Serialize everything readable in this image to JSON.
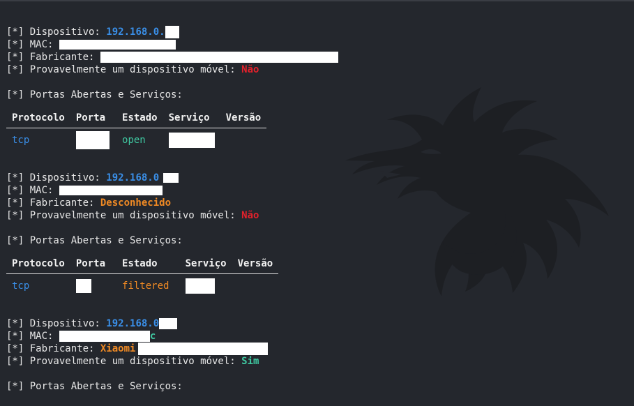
{
  "colors": {
    "background": "#24272d",
    "ip": "#3a8fe8",
    "negative": "#e3212b",
    "vendor": "#f08a24",
    "positive": "#3fc7a0"
  },
  "labels": {
    "device": "[*] Dispositivo: ",
    "mac": "[*] MAC: ",
    "vendor": "[*] Fabricante: ",
    "mobile": "[*] Provavelmente um dispositivo móvel: ",
    "ports_heading": "[*] Portas Abertas e Serviços:"
  },
  "table_headers": [
    "Protocolo",
    "Porta",
    "Estado",
    "Serviço",
    "Versão"
  ],
  "devices": [
    {
      "ip": "192.168.0.",
      "mac": "",
      "vendor": "",
      "mobile": "Não",
      "port_row": {
        "protocol": "tcp",
        "state": "open"
      }
    },
    {
      "ip": "192.168.0",
      "mac": "",
      "vendor": "Desconhecido",
      "mobile": "Não",
      "port_row": {
        "protocol": "tcp",
        "state": "filtered"
      }
    },
    {
      "ip": "192.168.0",
      "mac": "c",
      "vendor": "Xiaomi",
      "mobile": "Sim"
    }
  ],
  "background_icon": "dragon-logo-icon"
}
